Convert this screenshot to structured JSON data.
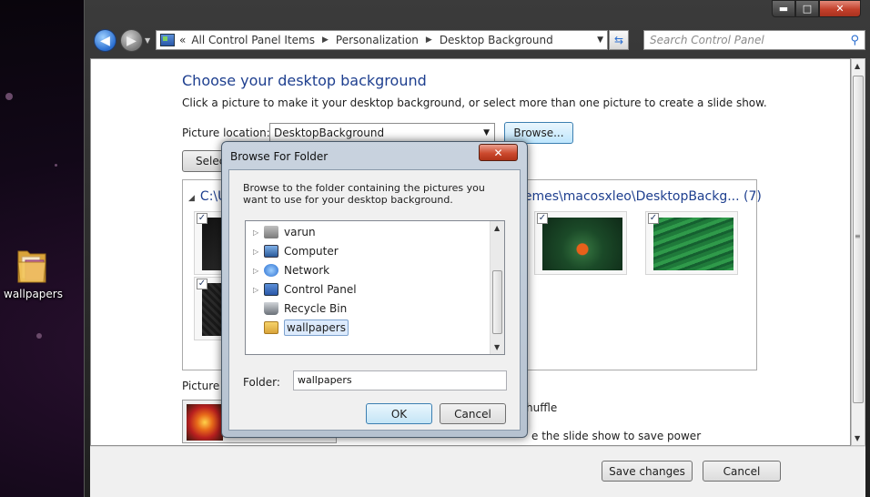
{
  "desktop": {
    "icon_label": "wallpapers"
  },
  "window": {
    "minimize": "▬",
    "maximize": "□",
    "close": "✕"
  },
  "nav": {
    "breadcrumb": [
      "«",
      "All Control Panel Items",
      "Personalization",
      "Desktop Background"
    ],
    "search_placeholder": "Search Control Panel"
  },
  "main": {
    "title": "Choose your desktop background",
    "description": "Click a picture to make it your desktop background, or select more than one picture to create a slide show.",
    "picture_location_label": "Picture location:",
    "picture_location_value": "DesktopBackground",
    "browse_label": "Browse...",
    "select_all_label": "Select",
    "group_header": "C:\\U",
    "group_header_tail": "hemes\\macosxleo\\DesktopBackg... (7)",
    "position_label": "Picture p",
    "shuffle_text": "huffle",
    "battery_text": "e the slide show to save power"
  },
  "footer": {
    "save_label": "Save changes",
    "cancel_label": "Cancel"
  },
  "dialog": {
    "title": "Browse For Folder",
    "close": "✕",
    "description": "Browse to the folder containing the pictures you want to use for your desktop background.",
    "tree": [
      {
        "label": "varun",
        "icon": "user-folder-icon",
        "expandable": true
      },
      {
        "label": "Computer",
        "icon": "computer-icon",
        "expandable": true
      },
      {
        "label": "Network",
        "icon": "network-icon",
        "expandable": true
      },
      {
        "label": "Control Panel",
        "icon": "control-panel-icon",
        "expandable": true
      },
      {
        "label": "Recycle Bin",
        "icon": "recycle-bin-icon",
        "expandable": false
      },
      {
        "label": "wallpapers",
        "icon": "folder-icon",
        "expandable": false,
        "selected": true
      }
    ],
    "folder_label": "Folder:",
    "folder_value": "wallpapers",
    "ok_label": "OK",
    "cancel_label": "Cancel"
  },
  "colors": {
    "title_blue": "#1e3f8f",
    "close_red": "#c3402b",
    "selection": "#dceafc"
  }
}
